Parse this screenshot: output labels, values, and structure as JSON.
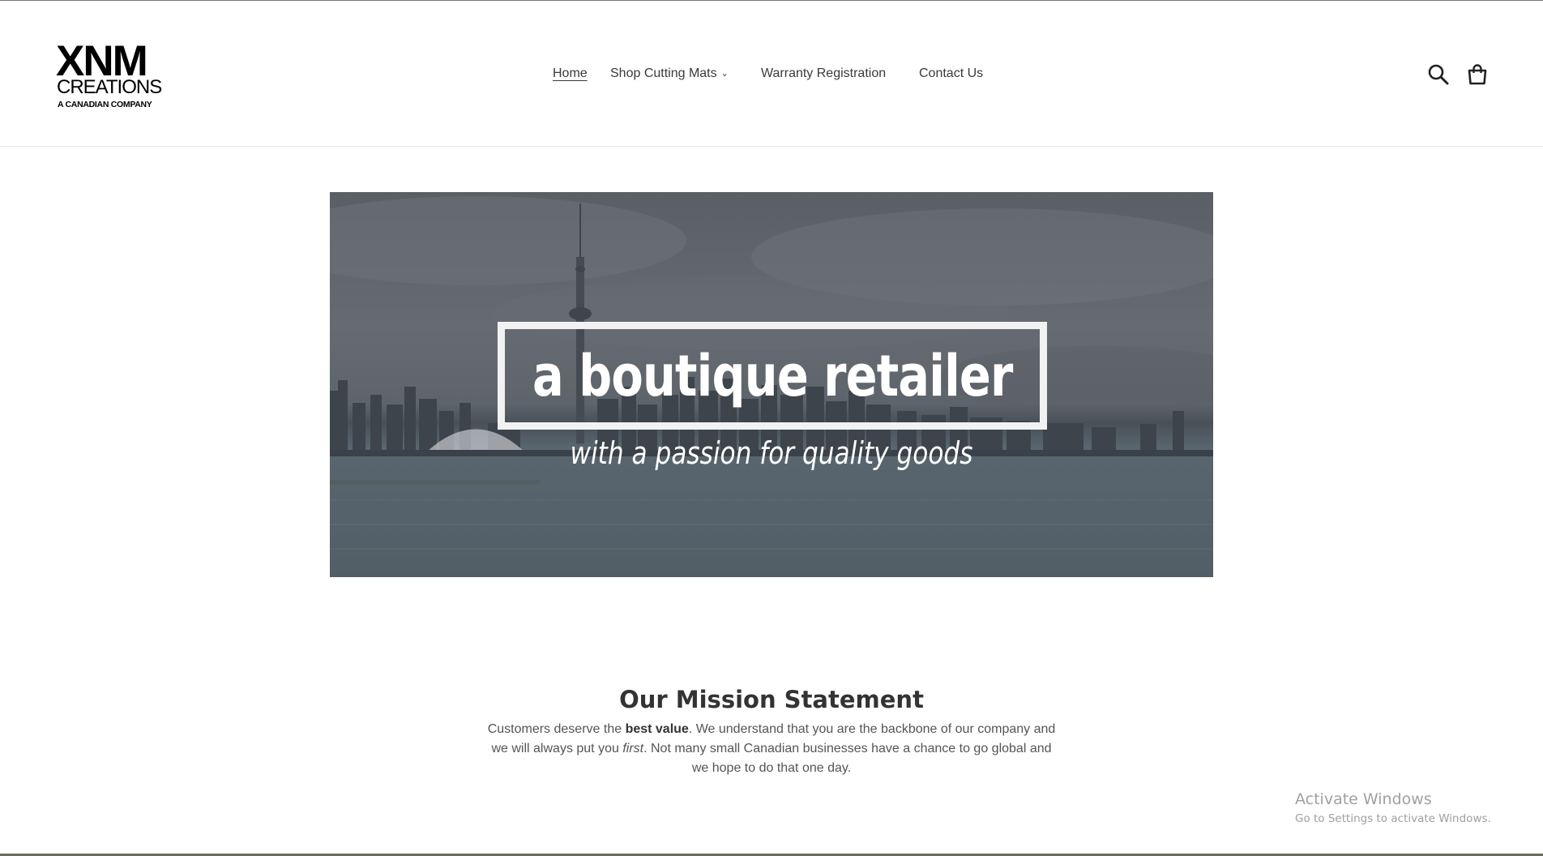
{
  "logo": {
    "line1": "XNM",
    "line2": "CREATIONS",
    "line3": "A CANADIAN COMPANY"
  },
  "nav": {
    "items": [
      {
        "label": "Home",
        "active": true
      },
      {
        "label": "Shop Cutting Mats",
        "has_dropdown": true
      },
      {
        "label": "Warranty Registration"
      },
      {
        "label": "Contact Us"
      }
    ],
    "dropdown_icon": "chevron-down-icon"
  },
  "header_icons": {
    "search": "search-icon",
    "cart": "cart-icon"
  },
  "hero": {
    "title": "a boutique retailer",
    "subtitle": "with a passion for quality goods",
    "image": "Toronto skyline with CN Tower over water"
  },
  "mission": {
    "title": "Our Mission Statement",
    "p1": "Customers deserve the ",
    "p1_bold": "best value",
    "p2": ".  We understand that you are the backbone of our company and we will always put you ",
    "p2_italic": "first",
    "p3": ".  Not many small Canadian businesses have a chance to go global and we hope to do that one day."
  },
  "os_watermark": {
    "line1": "Activate Windows",
    "line2": "Go to Settings to activate Windows."
  },
  "colors": {
    "text": "#3a3a3a",
    "hero_overlay": "#5e646b",
    "banner_text": "#ffffff"
  }
}
